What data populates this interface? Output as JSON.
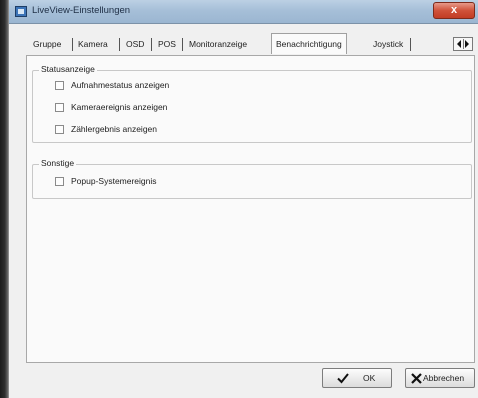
{
  "window": {
    "title": "LiveView-Einstellungen",
    "close_glyph": "x"
  },
  "tabs": [
    {
      "label": "Gruppe"
    },
    {
      "label": "Kamera"
    },
    {
      "label": "OSD"
    },
    {
      "label": "POS"
    },
    {
      "label": "Monitoranzeige"
    },
    {
      "label": "Benachrichtigung",
      "active": true
    },
    {
      "label": "Joystick"
    }
  ],
  "groups": {
    "statusanzeige": {
      "title": "Statusanzeige",
      "items": [
        {
          "label": "Aufnahmestatus anzeigen",
          "checked": false
        },
        {
          "label": "Kameraereignis anzeigen",
          "checked": false
        },
        {
          "label": "Zählergebnis anzeigen",
          "checked": false
        }
      ]
    },
    "sonstige": {
      "title": "Sonstige",
      "items": [
        {
          "label": "Popup-Systemereignis",
          "checked": false
        }
      ]
    }
  },
  "buttons": {
    "ok": "OK",
    "cancel": "Abbrechen"
  },
  "colors": {
    "titlebar": "#a6bfd8",
    "close": "#c8452c",
    "panel": "#fafafa"
  }
}
